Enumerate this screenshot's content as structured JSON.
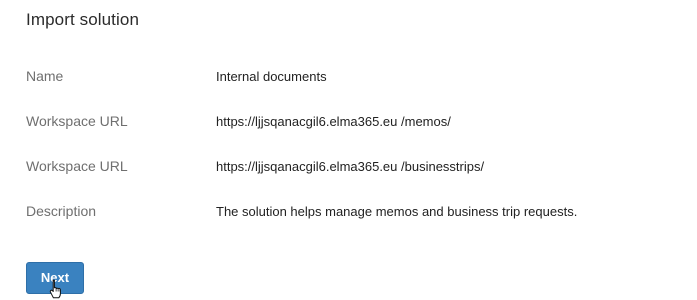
{
  "dialog": {
    "title": "Import solution"
  },
  "fields": [
    {
      "label": "Name",
      "value": "Internal documents"
    },
    {
      "label": "Workspace URL",
      "value": "https://ljjsqanacgil6.elma365.eu /memos/"
    },
    {
      "label": "Workspace URL",
      "value": "https://ljjsqanacgil6.elma365.eu /businesstrips/"
    },
    {
      "label": "Description",
      "value": "The solution helps manage memos and business trip requests."
    }
  ],
  "actions": {
    "next_label": "Next"
  },
  "icons": {
    "cursor": "hand-pointer-icon"
  },
  "colors": {
    "primary_button": "#3a82c0"
  }
}
